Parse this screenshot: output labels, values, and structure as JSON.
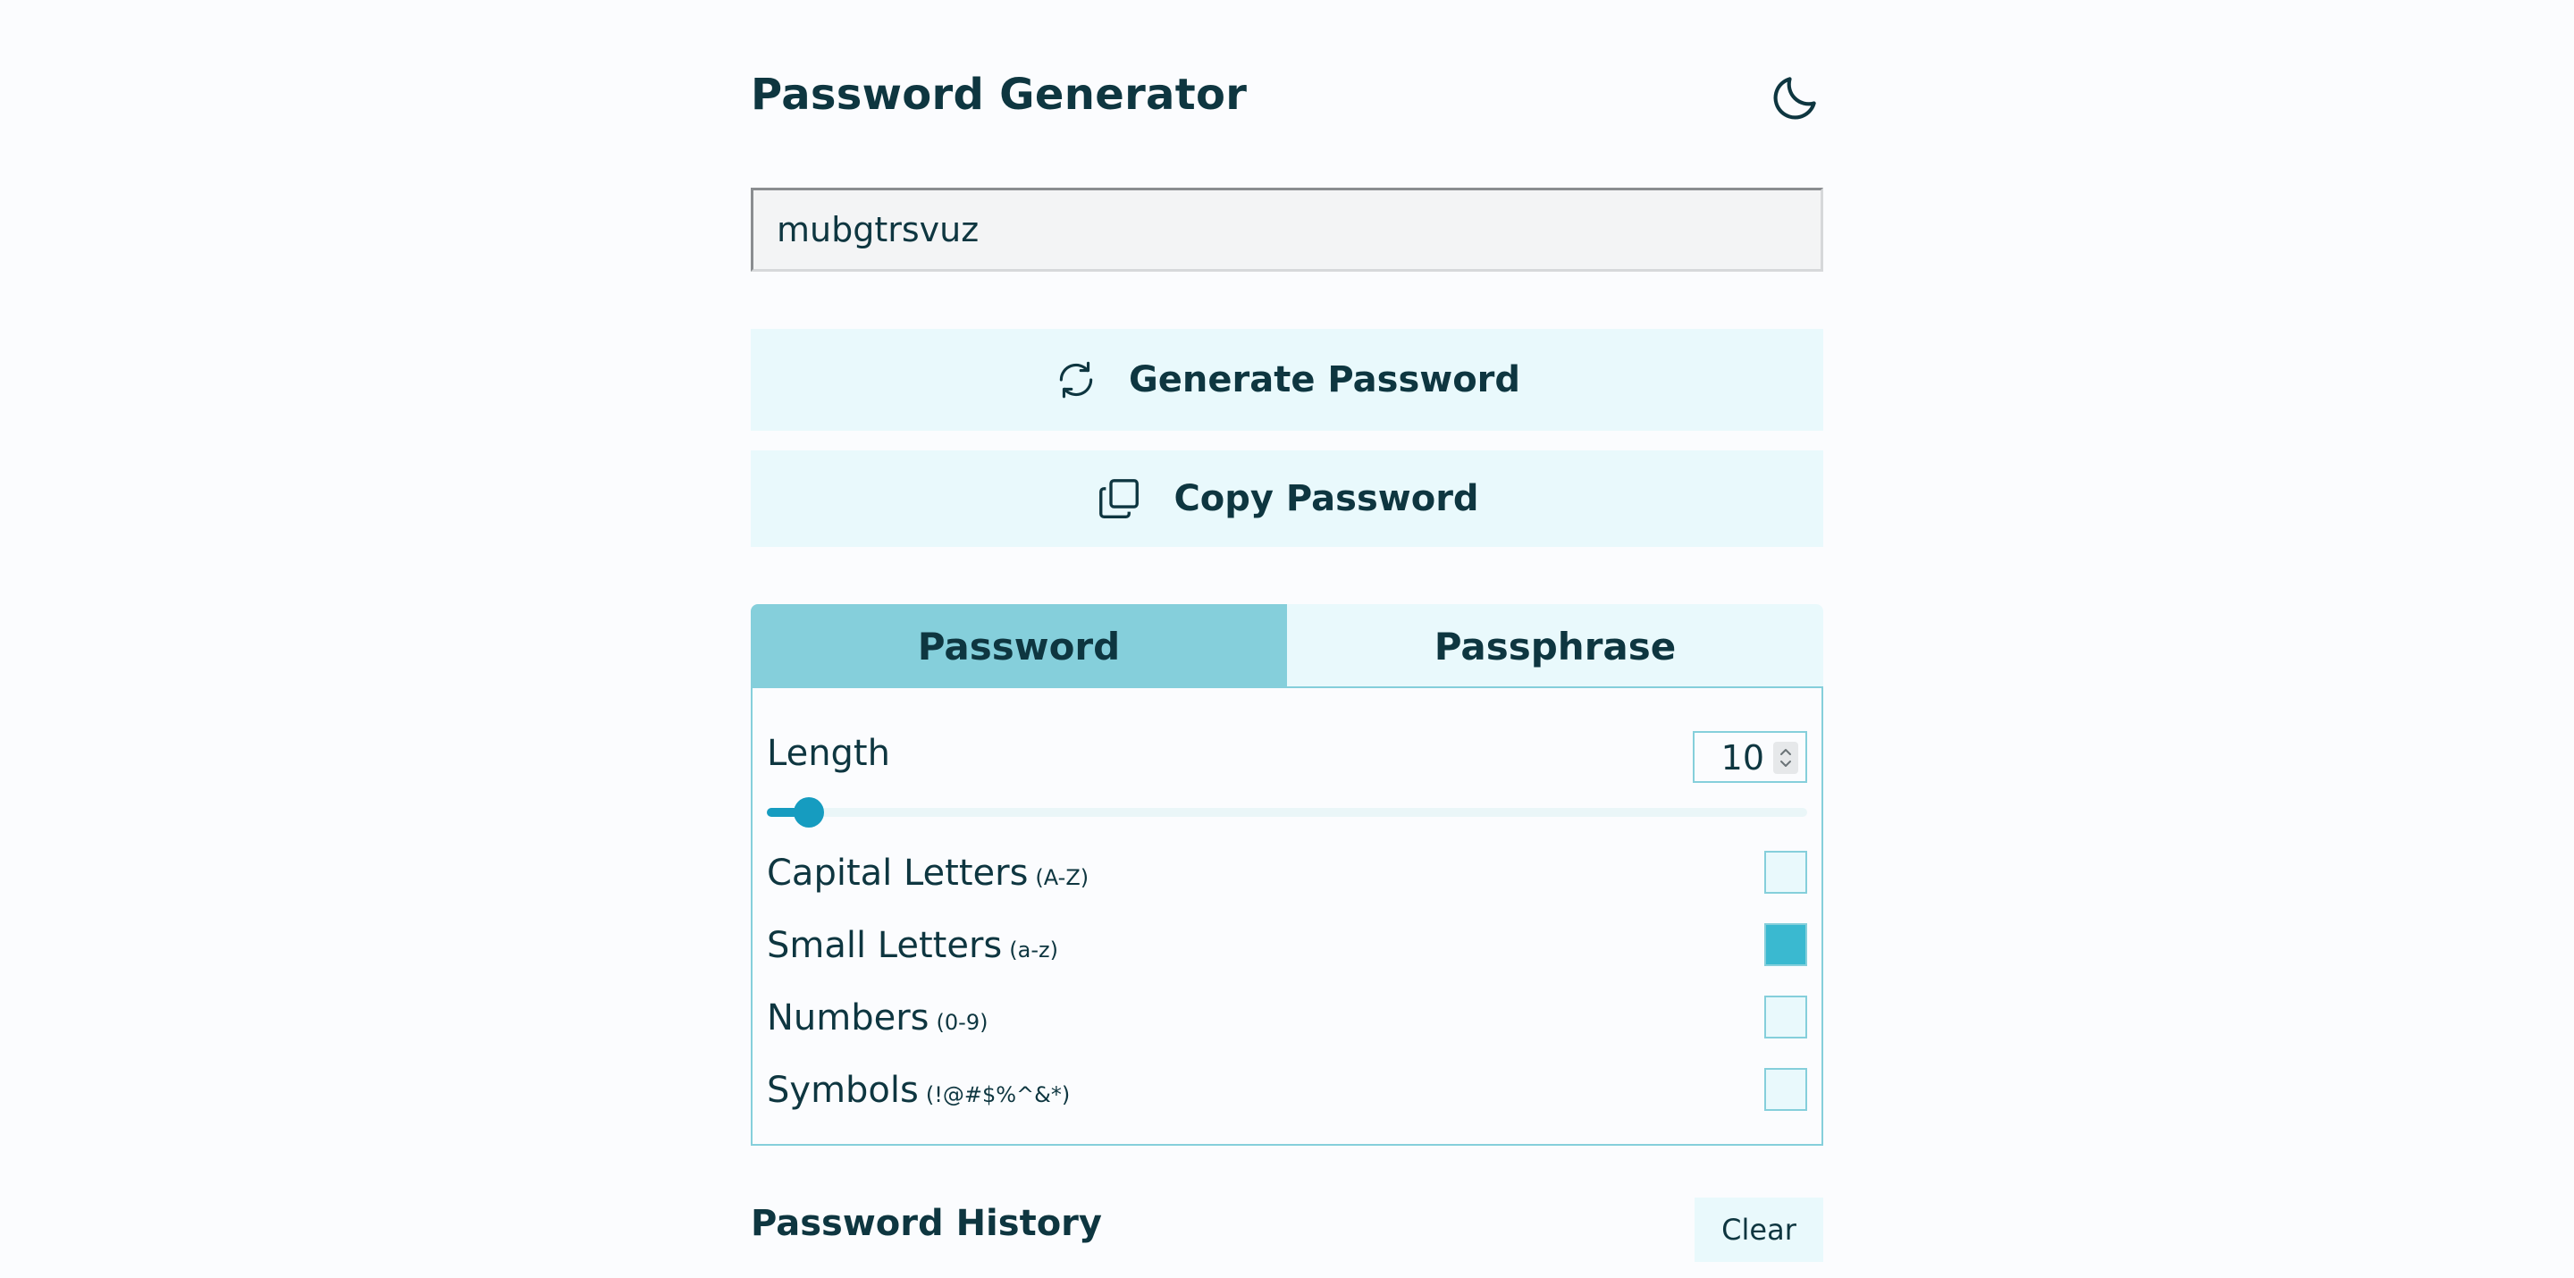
{
  "app": {
    "title": "Password Generator",
    "theme_toggle_icon": "moon-icon"
  },
  "output": {
    "password": "mubgtrsvuz"
  },
  "actions": {
    "generate_label": "Generate Password",
    "generate_icon": "refresh-icon",
    "copy_label": "Copy Password",
    "copy_icon": "copy-icon"
  },
  "tabs": [
    {
      "label": "Password",
      "active": true
    },
    {
      "label": "Passphrase",
      "active": false
    }
  ],
  "options": {
    "length_label": "Length",
    "length_value": "10",
    "length_slider_fraction": 0.04,
    "items": [
      {
        "label": "Capital Letters",
        "hint": "(A-Z)",
        "checked": false
      },
      {
        "label": "Small Letters",
        "hint": "(a-z)",
        "checked": true
      },
      {
        "label": "Numbers",
        "hint": "(0-9)",
        "checked": false
      },
      {
        "label": "Symbols",
        "hint": "(!@#$%^&*)",
        "checked": false
      }
    ]
  },
  "history": {
    "title": "Password History",
    "clear_label": "Clear"
  },
  "colors": {
    "accent": "#169cc0",
    "tab_active": "#85cfdb",
    "button_bg": "#e9f9fc",
    "text": "#0e3640",
    "checkbox_checked": "#3ab9d0"
  }
}
